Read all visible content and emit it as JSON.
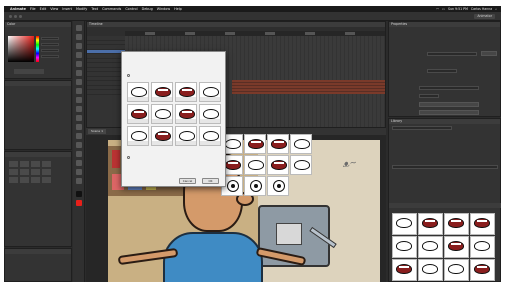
{
  "menubar": {
    "items": [
      "Animate",
      "File",
      "Edit",
      "View",
      "Insert",
      "Modify",
      "Text",
      "Commands",
      "Control",
      "Debug",
      "Window",
      "Help"
    ],
    "status": [
      "Sun 9:51 PM",
      "Carlos Hanna"
    ]
  },
  "appbar": {
    "workspace": "Animator"
  },
  "panels": {
    "color_title": "Color",
    "timeline_title": "Timeline",
    "properties_title": "Properties",
    "library_title": "Library"
  },
  "stage": {
    "scene_tab": "Scene 1"
  },
  "dialog": {
    "buttons": {
      "ok": "OK",
      "cancel": "Cancel"
    }
  },
  "colors": {
    "shirt": "#3f8bc4",
    "skin": "#d49a6a",
    "selection": "#4b6ea8",
    "timeline_red": "#7a3a2a"
  }
}
